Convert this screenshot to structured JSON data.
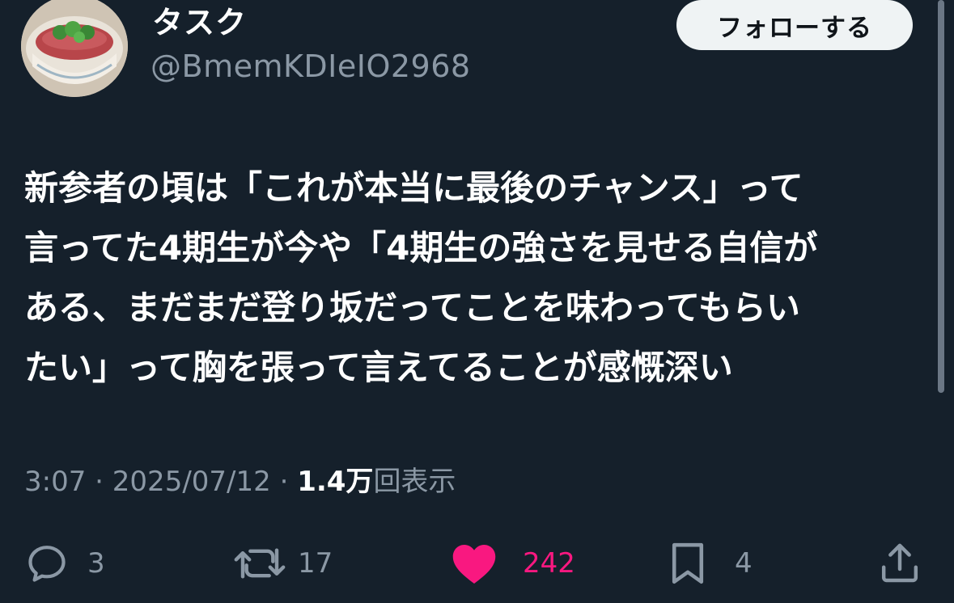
{
  "user": {
    "display_name": "タスク",
    "handle": "@BmemKDIeIO2968"
  },
  "follow_button": {
    "label": "フォローする"
  },
  "tweet": {
    "text_lines": [
      "新参者の頃は「これが本当に最後のチャンス」って",
      "言ってた4期生が今や「4期生の強さを見せる自信が",
      "ある、まだまだ登り坂だってことを味わってもらい",
      "たい」って胸を張って言えてることが感慨深い"
    ]
  },
  "meta": {
    "time": "3:07",
    "separator": " · ",
    "date": "2025/07/12",
    "views_count": "1.4万",
    "views_label": "回表示"
  },
  "actions": {
    "reply": {
      "icon": "reply-icon",
      "count": "3"
    },
    "retweet": {
      "icon": "retweet-icon",
      "count": "17"
    },
    "like": {
      "icon": "heart-icon",
      "count": "242",
      "liked": true
    },
    "bookmark": {
      "icon": "bookmark-icon",
      "count": "4"
    },
    "share": {
      "icon": "share-icon"
    }
  },
  "colors": {
    "background": "#15202b",
    "text": "#ffffff",
    "muted": "#8b98a5",
    "like": "#f91880",
    "follow_bg": "#eff3f4"
  }
}
